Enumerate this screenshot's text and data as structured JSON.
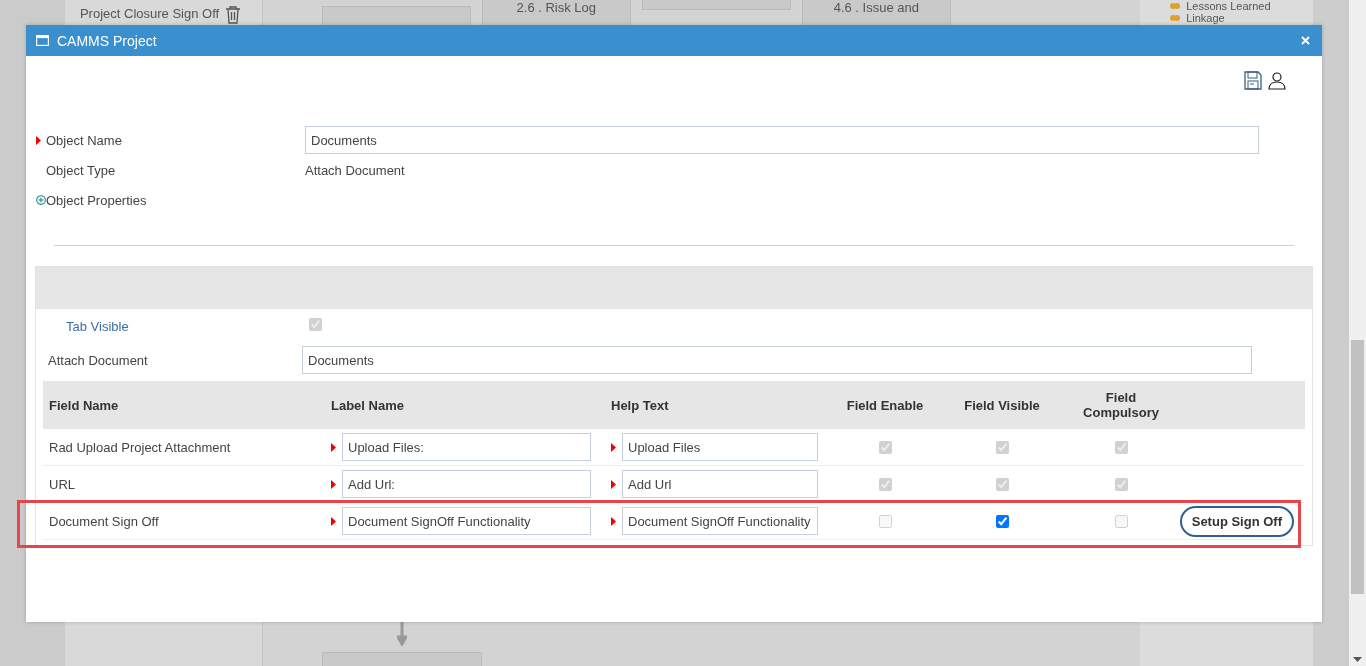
{
  "background": {
    "sidebar_item": "Project Closure Sign Off",
    "boxes": [
      {
        "label": "2.6 . Risk Log"
      },
      {
        "label": "4.6 . Issue and"
      }
    ],
    "right_items": [
      "Lessons Learned",
      "Linkage"
    ]
  },
  "window": {
    "title": "CAMMS Project"
  },
  "form": {
    "object_name": {
      "label": "Object Name",
      "required": true,
      "value": "Documents"
    },
    "object_type": {
      "label": "Object Type",
      "value": "Attach Document"
    },
    "object_properties": {
      "label": "Object Properties",
      "expanded": false
    }
  },
  "panel": {
    "tab_visible": {
      "label": "Tab Visible",
      "checked": true,
      "disabled": true
    },
    "attach_document": {
      "label": "Attach Document",
      "value": "Documents"
    },
    "table": {
      "columns": [
        "Field Name",
        "Label Name",
        "Help Text",
        "Field Enable",
        "Field Visible",
        "Field Compulsory"
      ],
      "rows": [
        {
          "field_name": "Rad Upload Project Attachment",
          "label_name": "Upload Files:",
          "help_text": "Upload Files",
          "field_enable": {
            "checked": true,
            "disabled": true
          },
          "field_visible": {
            "checked": true,
            "disabled": true
          },
          "field_compulsory": {
            "checked": true,
            "disabled": true
          },
          "highlighted": false
        },
        {
          "field_name": "URL",
          "label_name": "Add Url:",
          "help_text": "Add Url",
          "field_enable": {
            "checked": true,
            "disabled": true
          },
          "field_visible": {
            "checked": true,
            "disabled": true
          },
          "field_compulsory": {
            "checked": true,
            "disabled": true
          },
          "highlighted": false
        },
        {
          "field_name": "Document Sign Off",
          "label_name": "Document SignOff Functionality",
          "help_text": "Document SignOff Functionality",
          "field_enable": {
            "checked": false,
            "disabled": true
          },
          "field_visible": {
            "checked": true,
            "disabled": false
          },
          "field_compulsory": {
            "checked": false,
            "disabled": true
          },
          "action": "Setup Sign Off",
          "highlighted": true
        }
      ]
    }
  }
}
